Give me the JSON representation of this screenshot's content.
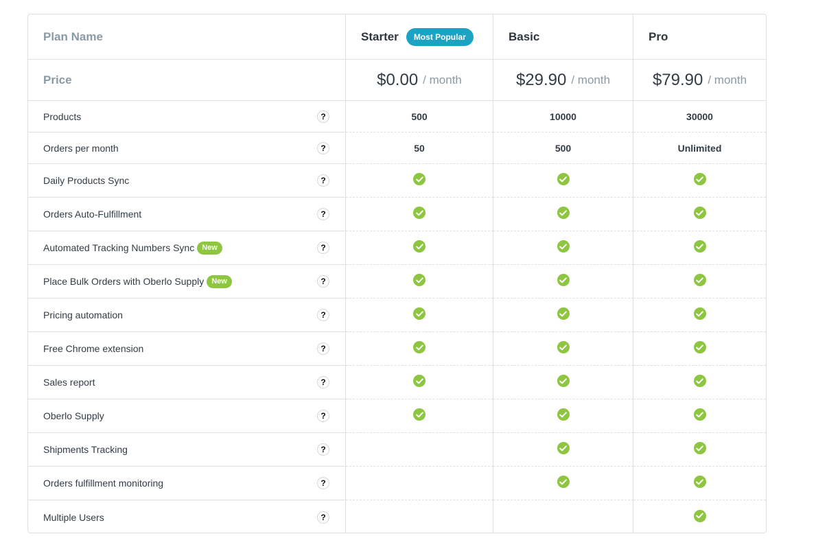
{
  "table": {
    "header": {
      "label": "Plan Name",
      "plans": [
        {
          "name": "Starter",
          "badge": "Most Popular"
        },
        {
          "name": "Basic"
        },
        {
          "name": "Pro"
        }
      ]
    },
    "price": {
      "label": "Price",
      "unit": "/ month",
      "amounts": [
        "$0.00",
        "$29.90",
        "$79.90"
      ]
    },
    "features": [
      {
        "label": "Products",
        "values": [
          "500",
          "10000",
          "30000"
        ]
      },
      {
        "label": "Orders per month",
        "values": [
          "50",
          "500",
          "Unlimited"
        ]
      },
      {
        "label": "Daily Products Sync",
        "checks": [
          true,
          true,
          true
        ]
      },
      {
        "label": "Orders Auto-Fulfillment",
        "checks": [
          true,
          true,
          true
        ]
      },
      {
        "label": "Automated Tracking Numbers Sync",
        "badge": "New",
        "checks": [
          true,
          true,
          true
        ]
      },
      {
        "label": "Place Bulk Orders with Oberlo Supply",
        "badge": "New",
        "checks": [
          true,
          true,
          true
        ]
      },
      {
        "label": "Pricing automation",
        "checks": [
          true,
          true,
          true
        ]
      },
      {
        "label": "Free Chrome extension",
        "checks": [
          true,
          true,
          true
        ]
      },
      {
        "label": "Sales report",
        "checks": [
          true,
          true,
          true
        ]
      },
      {
        "label": "Oberlo Supply",
        "checks": [
          true,
          true,
          true
        ]
      },
      {
        "label": "Shipments Tracking",
        "checks": [
          false,
          true,
          true
        ]
      },
      {
        "label": "Orders fulfillment monitoring",
        "checks": [
          false,
          true,
          true
        ]
      },
      {
        "label": "Multiple Users",
        "checks": [
          false,
          false,
          true
        ]
      }
    ],
    "help_icon": "question-icon",
    "check_icon": "check-circle-icon",
    "help_glyph": "?",
    "colors": {
      "check": "#8ec641",
      "new_badge": "#8ec641",
      "popular_badge": "#1ca3c4",
      "muted_text": "#8a9aa6",
      "border": "#dcdfe3"
    }
  }
}
